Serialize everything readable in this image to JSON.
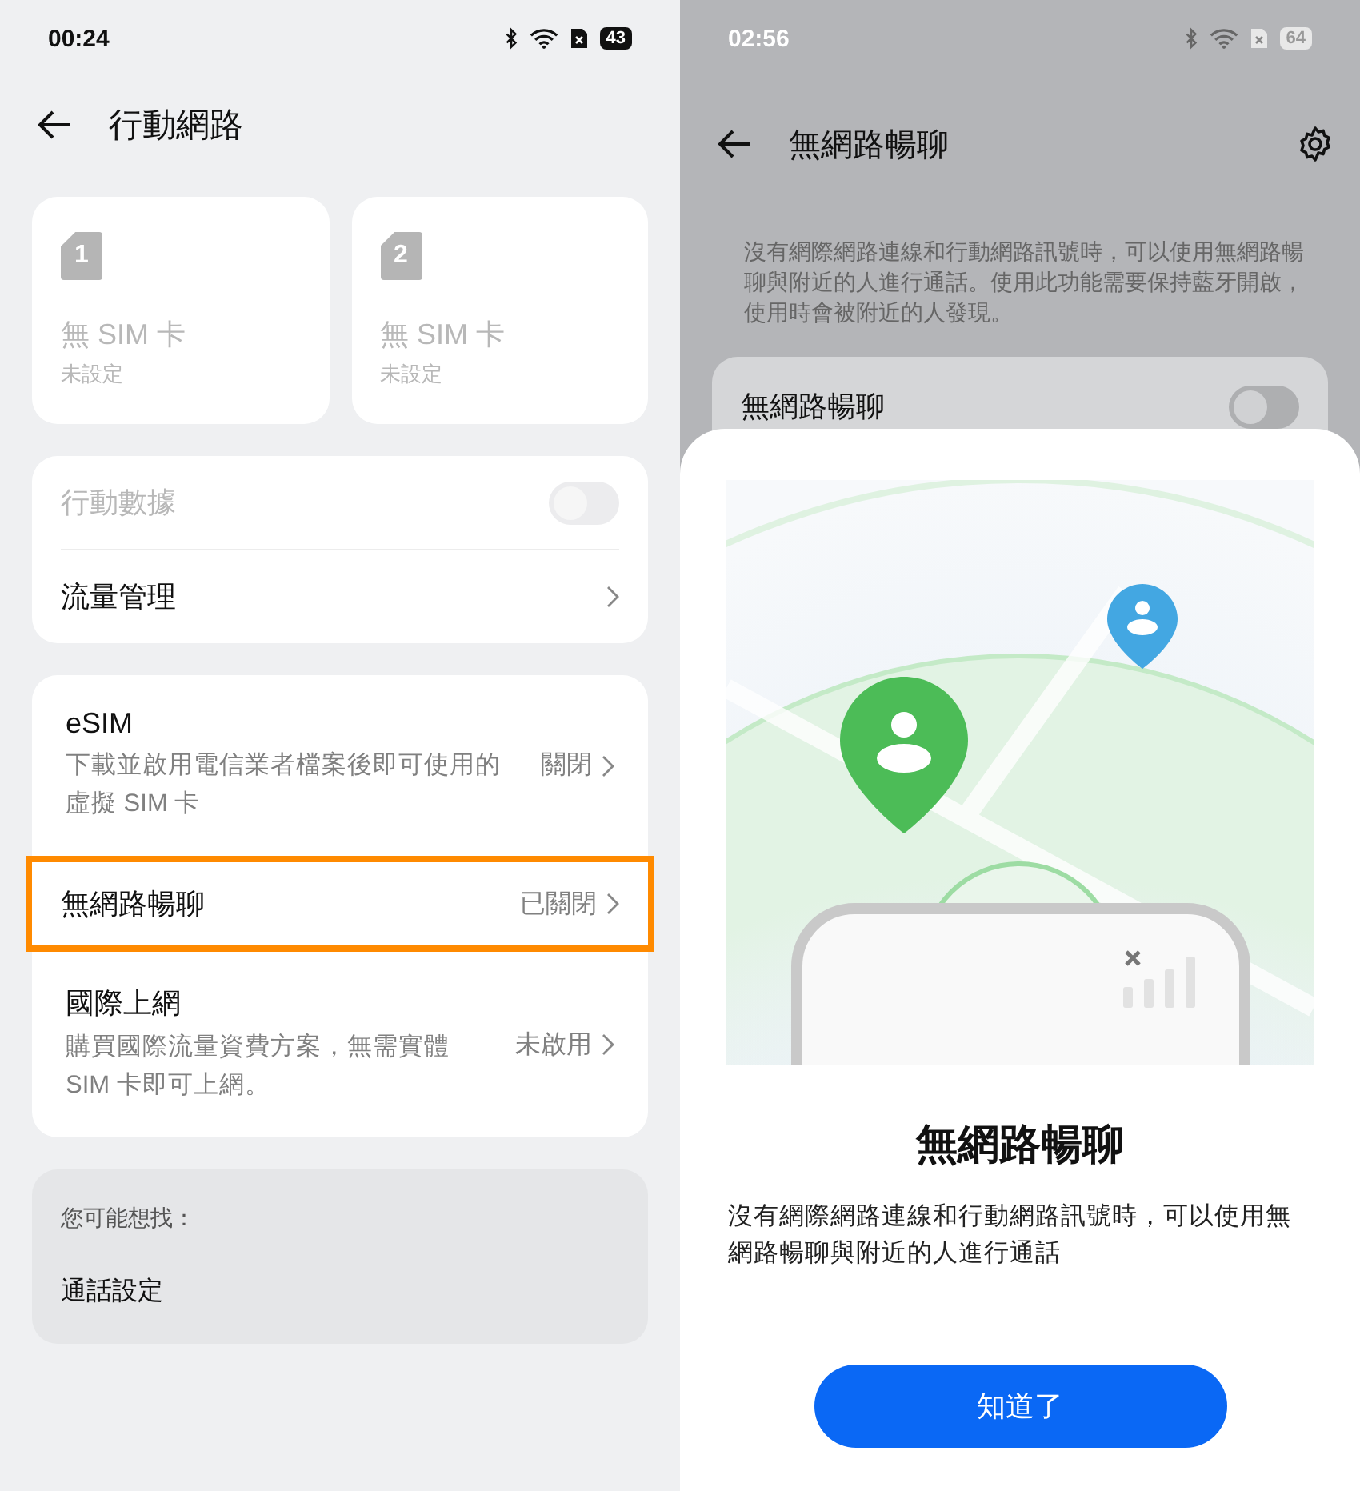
{
  "left_screen": {
    "status_bar": {
      "time": "00:24",
      "battery": "43"
    },
    "title": "行動網路",
    "sim_cards": [
      {
        "number": "1",
        "name": "無 SIM 卡",
        "status": "未設定"
      },
      {
        "number": "2",
        "name": "無 SIM 卡",
        "status": "未設定"
      }
    ],
    "data_rows": [
      {
        "kind": "toggle",
        "label": "行動數據",
        "on": false,
        "disabled": true
      },
      {
        "kind": "link",
        "label": "流量管理",
        "disabled": false
      }
    ],
    "services": [
      {
        "title": "eSIM",
        "description": "下載並啟用電信業者檔案後即可使用的虛擬 SIM 卡",
        "value": "關閉",
        "highlighted": false
      },
      {
        "title": "無網路暢聊",
        "value": "已關閉",
        "highlighted": true
      },
      {
        "title": "國際上網",
        "description": "購買國際流量資費方案，無需實體 SIM 卡即可上網。",
        "value": "未啟用",
        "highlighted": false
      }
    ],
    "suggestions": {
      "heading": "您可能想找：",
      "items": [
        "通話設定"
      ]
    }
  },
  "right_screen": {
    "status_bar": {
      "time": "02:56",
      "battery": "64"
    },
    "title": "無網路暢聊",
    "description": "沒有網際網路連線和行動網路訊號時，可以使用無網路暢聊與附近的人進行通話。使用此功能需要保持藍牙開啟，使用時會被附近的人發現。",
    "toggle": {
      "label": "無網路暢聊",
      "on": false
    },
    "sheet": {
      "title": "無網路暢聊",
      "text": "沒有網際網路連線和行動網路訊號時，可以使用無網路暢聊與附近的人進行通話",
      "button": "知道了"
    }
  }
}
